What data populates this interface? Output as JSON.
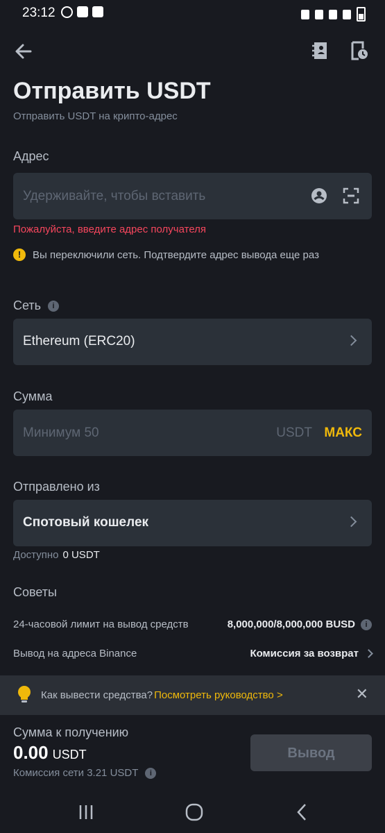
{
  "status_bar": {
    "time": "23:12"
  },
  "header": {
    "title": "Отправить USDT",
    "subtitle": "Отправить USDT на крипто-адрес"
  },
  "address": {
    "label": "Адрес",
    "placeholder": "Удерживайте, чтобы вставить",
    "error": "Пожалуйста, введите адрес получателя",
    "warning": "Вы переключили сеть. Подтвердите адрес вывода еще раз"
  },
  "network": {
    "label": "Сеть",
    "value": "Ethereum (ERC20)"
  },
  "amount": {
    "label": "Сумма",
    "placeholder": "Минимум 50",
    "unit": "USDT",
    "max_label": "МАКС"
  },
  "source": {
    "label": "Отправлено из",
    "value": "Спотовый кошелек",
    "available_label": "Доступно",
    "available_value": "0 USDT"
  },
  "tips": {
    "title": "Советы",
    "rows": [
      {
        "label": "24-часовой лимит на вывод средств",
        "value": "8,000,000/8,000,000 BUSD"
      },
      {
        "label": "Вывод на адреса Binance",
        "value": "Комиссия за возврат"
      }
    ]
  },
  "banner": {
    "text": "Как вывести средства?",
    "link": "Посмотреть руководство >",
    "close": "✕"
  },
  "summary": {
    "receive_label": "Сумма к получению",
    "receive_value": "0.00",
    "receive_unit": "USDT",
    "fee_label": "Комиссия сети 3.21 USDT",
    "withdraw_button": "Вывод"
  },
  "colors": {
    "background": "#181a20",
    "field": "#2b3139",
    "accent": "#f0b90b",
    "error": "#f6465d"
  }
}
